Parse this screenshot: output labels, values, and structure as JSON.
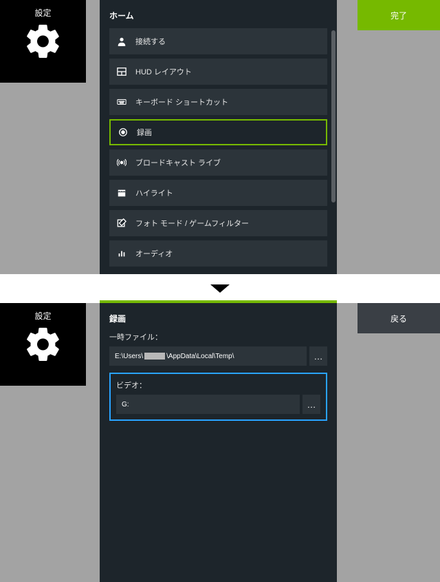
{
  "settings_label": "設定",
  "top_panel": {
    "title": "ホーム",
    "done_button": "完了",
    "menu": [
      {
        "label": "接続する",
        "icon": "user-icon"
      },
      {
        "label": "HUD レイアウト",
        "icon": "layout-icon"
      },
      {
        "label": "キーボード ショートカット",
        "icon": "keyboard-icon"
      },
      {
        "label": "録画",
        "icon": "record-icon",
        "selected": true
      },
      {
        "label": "ブロードキャスト ライブ",
        "icon": "broadcast-icon"
      },
      {
        "label": "ハイライト",
        "icon": "highlight-icon"
      },
      {
        "label": "フォト モード / ゲームフィルター",
        "icon": "photo-icon"
      },
      {
        "label": "オーディオ",
        "icon": "audio-icon"
      }
    ]
  },
  "bot_panel": {
    "title": "録画",
    "back_button": "戻る",
    "temp_label": "一時ファイル：",
    "temp_path_prefix": "E:\\Users\\",
    "temp_path_suffix": "\\AppData\\Local\\Temp\\",
    "video_label": "ビデオ：",
    "video_path": "G:",
    "browse": "…"
  }
}
